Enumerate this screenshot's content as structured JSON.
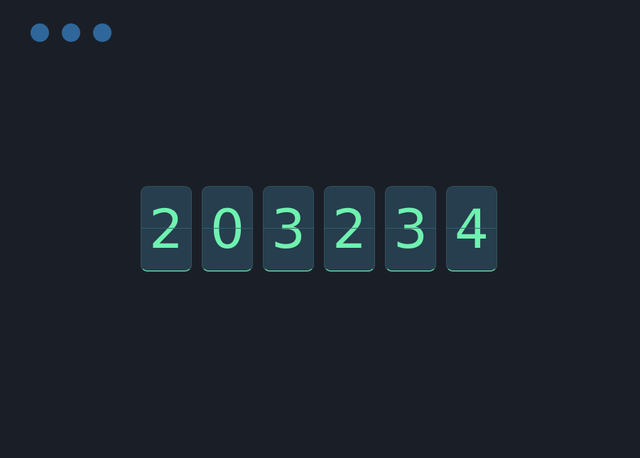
{
  "colors": {
    "background": "#1a1f27",
    "window_dot": "#2f679b",
    "card": "#263e4d",
    "digit": "#6ff2b0"
  },
  "window_controls": [
    {
      "icon": "window-dot"
    },
    {
      "icon": "window-dot"
    },
    {
      "icon": "window-dot"
    }
  ],
  "counter": {
    "digits": [
      "2",
      "0",
      "3",
      "2",
      "3",
      "4"
    ]
  }
}
